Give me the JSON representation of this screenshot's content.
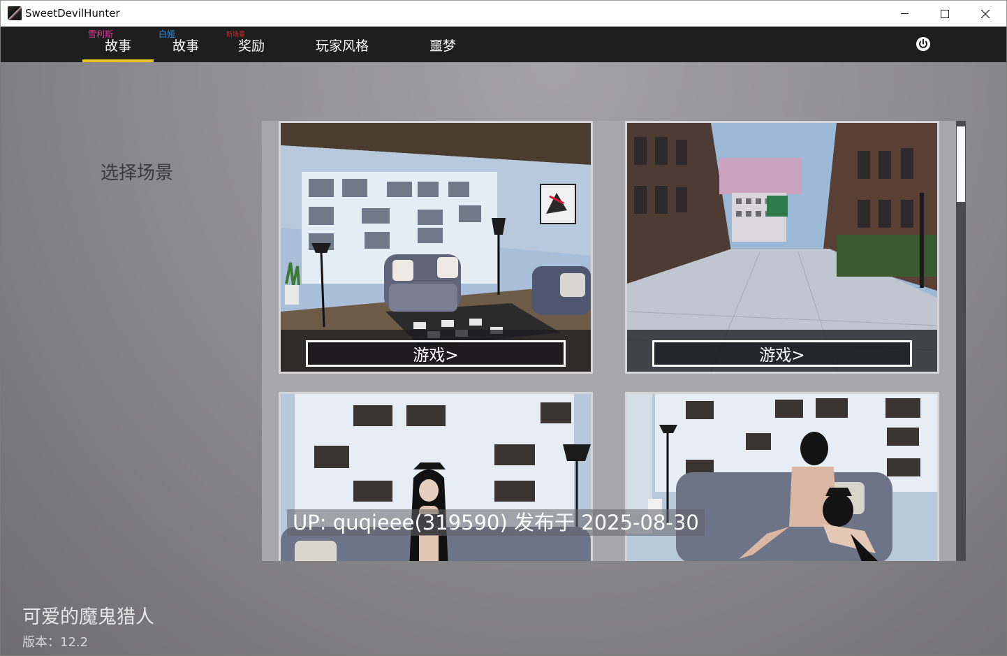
{
  "window": {
    "title": "SweetDevilHunter",
    "controls": [
      "minimize",
      "maximize",
      "close"
    ]
  },
  "nav": {
    "tabs": [
      {
        "label": "故事",
        "tag": "雪利斯",
        "tag_color": "#e0349a",
        "active": true
      },
      {
        "label": "故事",
        "tag": "白娅",
        "tag_color": "#2b8fe0",
        "active": false
      },
      {
        "label": "奖励",
        "tag": "新场景",
        "tag_color": "#e0292b",
        "active": false
      },
      {
        "label": "玩家风格",
        "tag": "",
        "active": false
      },
      {
        "label": "噩梦",
        "tag": "",
        "active": false
      }
    ],
    "power_icon": "power-icon",
    "active_underline_color": "#e8c21a"
  },
  "main": {
    "section_title": "选择场景",
    "scenes": [
      {
        "image": "living-room-scene",
        "play_label": "游戏>"
      },
      {
        "image": "city-street-scene",
        "play_label": "游戏>"
      },
      {
        "image": "bookshelf-character-scene",
        "play_label": ""
      },
      {
        "image": "sofa-characters-scene",
        "play_label": ""
      }
    ],
    "watermark": "UP: quqieee(319590) 发布于 2025-08-30"
  },
  "footer": {
    "game_title": "可爱的魔鬼猎人",
    "version": "版本：12.2"
  }
}
